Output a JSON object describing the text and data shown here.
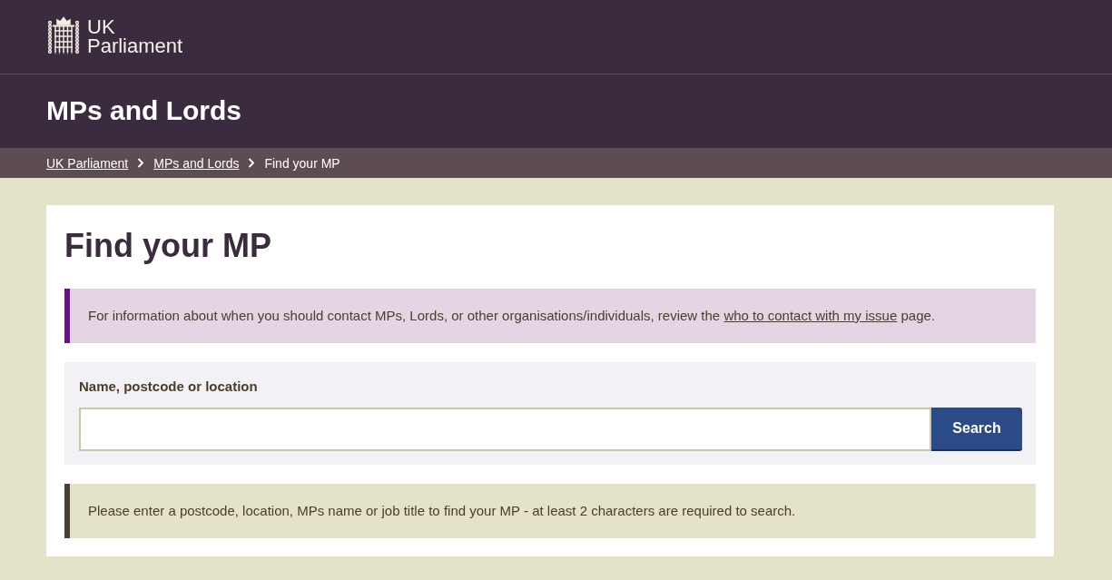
{
  "header": {
    "logo_text": "UK Parliament"
  },
  "section_title": "MPs and Lords",
  "breadcrumb": [
    {
      "label": "UK Parliament",
      "kind": "link"
    },
    {
      "label": "MPs and Lords",
      "kind": "link"
    },
    {
      "label": "Find your MP",
      "kind": "current"
    }
  ],
  "page": {
    "heading": "Find your MP",
    "info_notice": {
      "text_before": "For information about when you should contact MPs, Lords, or other organisations/individuals, review the ",
      "link": "who to contact with my issue",
      "text_after": " page."
    },
    "search": {
      "label": "Name, postcode or location",
      "button": "Search"
    },
    "hint_notice": "Please enter a postcode, location, MPs name or job title to find your MP - at least 2 characters are required to search."
  }
}
